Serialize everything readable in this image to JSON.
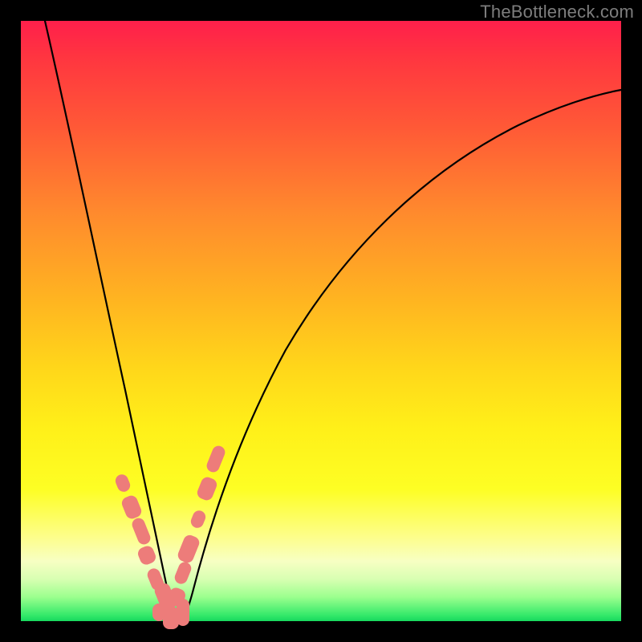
{
  "watermark": "TheBottleneck.com",
  "colors": {
    "gradient_top": "#ff1f4b",
    "gradient_mid": "#fff019",
    "gradient_bottom": "#17d85e",
    "curve": "#000000",
    "dots": "#ed7c7a",
    "frame": "#000000"
  },
  "chart_data": {
    "type": "line",
    "title": "",
    "xlabel": "",
    "ylabel": "",
    "xlim": [
      0,
      100
    ],
    "ylim": [
      0,
      100
    ],
    "notch_x": 25,
    "series": [
      {
        "name": "left-branch",
        "x": [
          4,
          6,
          8,
          10,
          12,
          14,
          16,
          18,
          20,
          22,
          23,
          24,
          25
        ],
        "y": [
          100,
          90,
          80,
          70,
          60,
          50,
          41,
          32,
          23,
          14,
          9,
          4,
          0
        ]
      },
      {
        "name": "right-branch",
        "x": [
          25,
          26,
          27,
          28,
          30,
          34,
          40,
          48,
          58,
          70,
          84,
          100
        ],
        "y": [
          0,
          5,
          10,
          15,
          24,
          38,
          53,
          65,
          74,
          80,
          84,
          87
        ]
      }
    ],
    "clusters": [
      {
        "name": "left-cluster",
        "points_approx": [
          [
            17,
            23
          ],
          [
            18.5,
            19
          ],
          [
            20,
            15
          ],
          [
            21,
            11
          ],
          [
            22.5,
            7
          ],
          [
            24,
            4
          ]
        ]
      },
      {
        "name": "right-cluster",
        "points_approx": [
          [
            26,
            4
          ],
          [
            27,
            8
          ],
          [
            28,
            12
          ],
          [
            29.5,
            17
          ],
          [
            31,
            22
          ],
          [
            32.5,
            27
          ]
        ]
      },
      {
        "name": "bottom-cluster",
        "points_approx": [
          [
            23,
            1.5
          ],
          [
            25,
            0.5
          ],
          [
            27,
            1.5
          ]
        ]
      }
    ]
  }
}
